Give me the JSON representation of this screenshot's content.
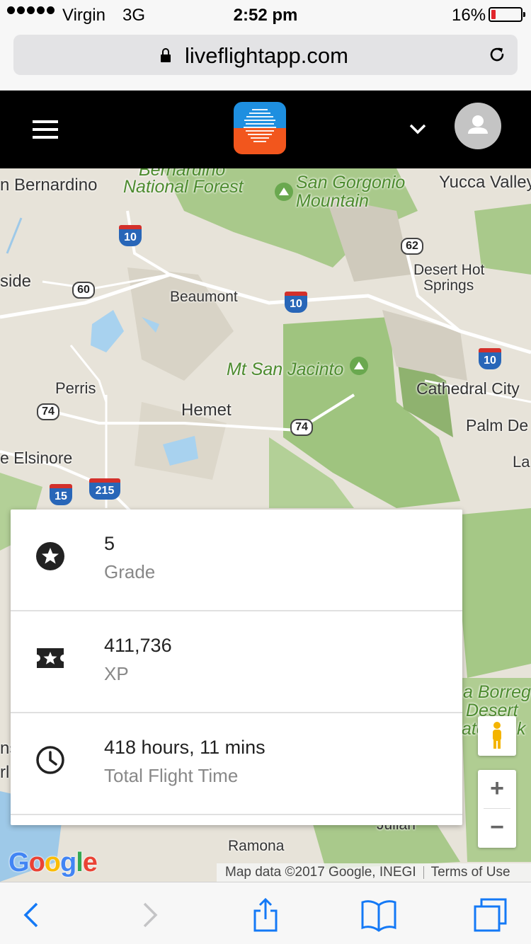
{
  "status_bar": {
    "carrier": "Virgin",
    "network": "3G",
    "time": "2:52 pm",
    "battery_percent": "16%",
    "battery_level": 0.16,
    "battery_color": "#e1262c"
  },
  "browser": {
    "domain": "liveflightapp.com"
  },
  "app_header": {
    "logo_colors": [
      "#1e8fe0",
      "#f2561d"
    ]
  },
  "map": {
    "places": [
      "n Bernardino",
      "Bernardino",
      "National Forest",
      "San Gorgonio",
      "Mountain",
      "Yucca Valley",
      "Desert Hot",
      "Springs",
      "side",
      "Beaumont",
      "Mt San Jacinto",
      "Perris",
      "Hemet",
      "Cathedral City",
      "Palm De",
      "e Elsinore",
      "La",
      "a Borreg",
      "Desert",
      "ate",
      "k",
      "ns",
      "rl",
      "Ramona",
      "Julian"
    ],
    "highways": [
      "10",
      "62",
      "60",
      "10",
      "10",
      "74",
      "74",
      "15",
      "215"
    ],
    "google_logo": "Google",
    "attribution": "Map data ©2017 Google, INEGI",
    "terms": "Terms of Use",
    "zoom_in": "+",
    "zoom_out": "−"
  },
  "stats": [
    {
      "value": "5",
      "label": "Grade",
      "icon": "star-circle-icon"
    },
    {
      "value": "411,736",
      "label": "XP",
      "icon": "ticket-star-icon"
    },
    {
      "value": "418 hours, 11 mins",
      "label": "Total Flight Time",
      "icon": "clock-icon"
    }
  ]
}
